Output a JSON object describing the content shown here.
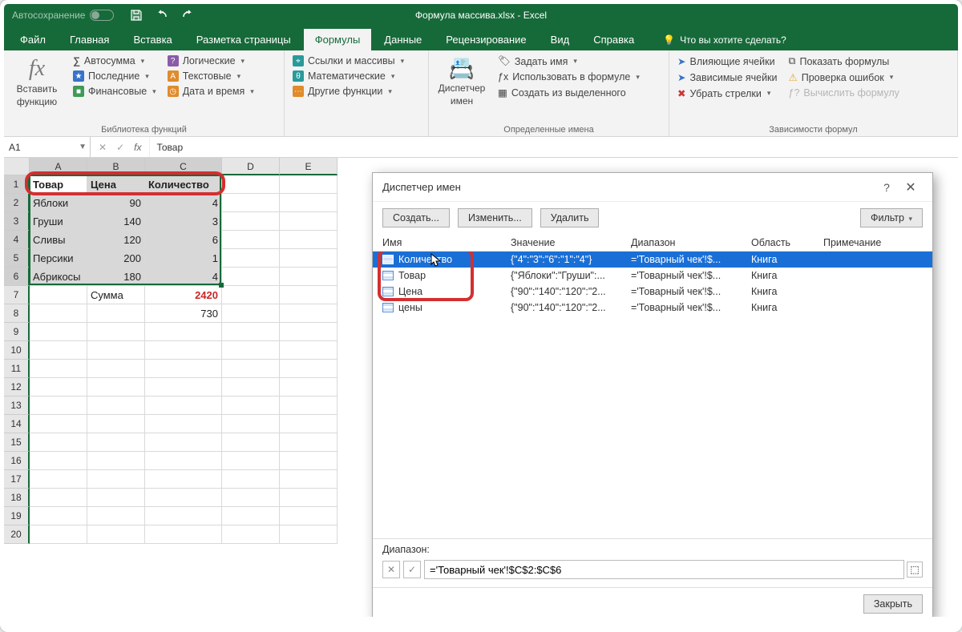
{
  "title": "Формула массива.xlsx - Excel",
  "autosave_label": "Автосохранение",
  "tabs": [
    "Файл",
    "Главная",
    "Вставка",
    "Разметка страницы",
    "Формулы",
    "Данные",
    "Рецензирование",
    "Вид",
    "Справка"
  ],
  "active_tab_index": 4,
  "tellme": "Что вы хотите сделать?",
  "ribbon": {
    "insert_fn_top": "Вставить",
    "insert_fn_bottom": "функцию",
    "lib": {
      "autosum": "Автосумма",
      "recent": "Последние",
      "financial": "Финансовые",
      "logical": "Логические",
      "text": "Текстовые",
      "datetime": "Дата и время",
      "lookup": "Ссылки и массивы",
      "math": "Математические",
      "more": "Другие функции",
      "group": "Библиотека функций"
    },
    "names": {
      "mgr_top": "Диспетчер",
      "mgr_bottom": "имен",
      "define": "Задать имя",
      "use": "Использовать в формуле",
      "create": "Создать из выделенного",
      "group": "Определенные имена"
    },
    "audit": {
      "precedents": "Влияющие ячейки",
      "dependents": "Зависимые ячейки",
      "remove": "Убрать стрелки",
      "show": "Показать формулы",
      "check": "Проверка ошибок",
      "eval": "Вычислить формулу",
      "group": "Зависимости формул"
    }
  },
  "namebox": "A1",
  "formula": "Товар",
  "columns": [
    "A",
    "B",
    "C",
    "D",
    "E"
  ],
  "sheet": {
    "headers": [
      "Товар",
      "Цена",
      "Количество"
    ],
    "rows": [
      {
        "a": "Яблоки",
        "b": "90",
        "c": "4"
      },
      {
        "a": "Груши",
        "b": "140",
        "c": "3"
      },
      {
        "a": "Сливы",
        "b": "120",
        "c": "6"
      },
      {
        "a": "Персики",
        "b": "200",
        "c": "1"
      },
      {
        "a": "Абрикосы",
        "b": "180",
        "c": "4"
      }
    ],
    "sum_label": "Сумма",
    "sum_value": "2420",
    "row8_c": "730"
  },
  "dialog": {
    "title": "Диспетчер имен",
    "btn_new": "Создать...",
    "btn_edit": "Изменить...",
    "btn_delete": "Удалить",
    "btn_filter": "Фильтр",
    "cols": {
      "name": "Имя",
      "value": "Значение",
      "range": "Диапазон",
      "scope": "Область",
      "note": "Примечание"
    },
    "rows": [
      {
        "name": "Количество",
        "value": "{\"4\":\"3\":\"6\":\"1\":\"4\"}",
        "range": "='Товарный чек'!$...",
        "scope": "Книга"
      },
      {
        "name": "Товар",
        "value": "{\"Яблоки\":\"Груши\":...",
        "range": "='Товарный чек'!$...",
        "scope": "Книга"
      },
      {
        "name": "Цена",
        "value": "{\"90\":\"140\":\"120\":\"2...",
        "range": "='Товарный чек'!$...",
        "scope": "Книга"
      },
      {
        "name": "цены",
        "value": "{\"90\":\"140\":\"120\":\"2...",
        "range": "='Товарный чек'!$...",
        "scope": "Книга"
      }
    ],
    "range_label": "Диапазон:",
    "range_value": "='Товарный чек'!$C$2:$C$6",
    "btn_close": "Закрыть"
  }
}
